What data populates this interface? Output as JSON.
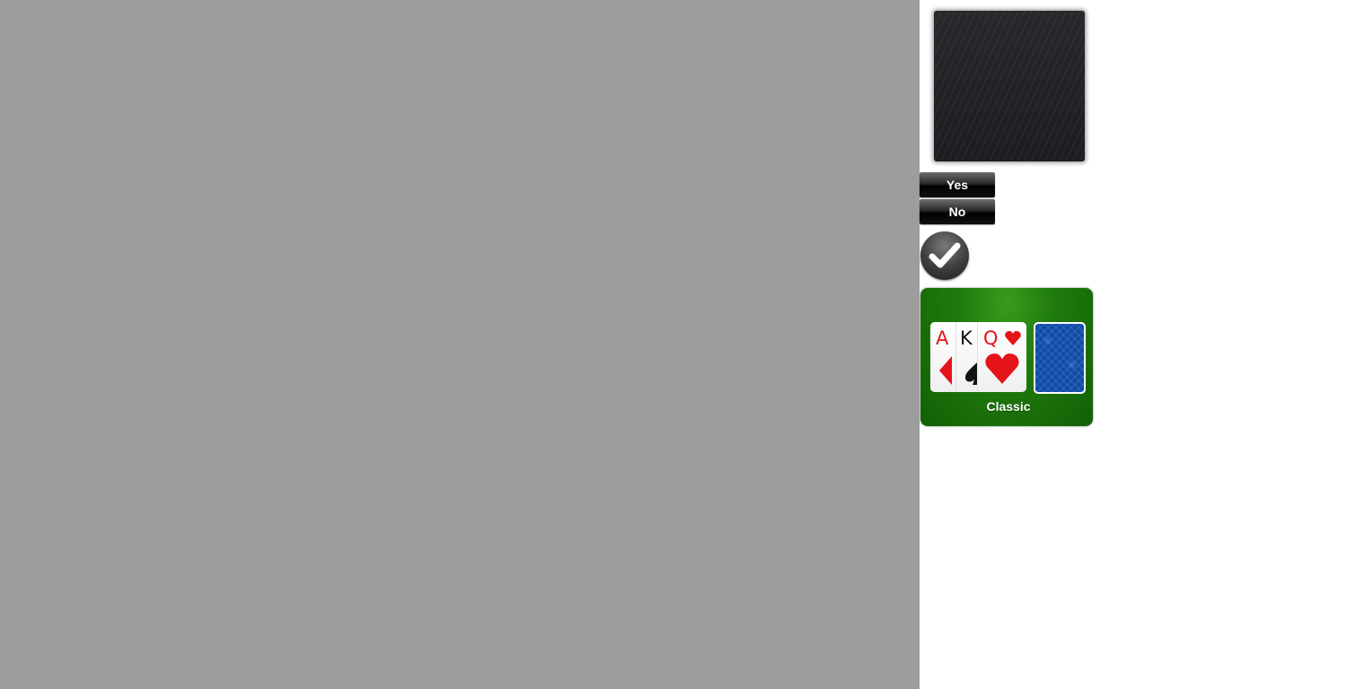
{
  "dialog": {
    "yes_label": "Yes",
    "no_label": "No",
    "confirm_icon": "check-icon"
  },
  "theme_option": {
    "label": "Classic",
    "cards": [
      {
        "rank": "A",
        "suit": "diamond",
        "color": "#e5131a"
      },
      {
        "rank": "K",
        "suit": "spade",
        "color": "#111111"
      },
      {
        "rank": "Q",
        "suit": "heart",
        "color": "#e5131a"
      }
    ],
    "card_back_color": "#0e4aa8",
    "felt_color": "#1f7a0c"
  },
  "colors": {
    "overlay": "#9d9d9d",
    "button": "#000000",
    "panel": "#1c1d20"
  }
}
